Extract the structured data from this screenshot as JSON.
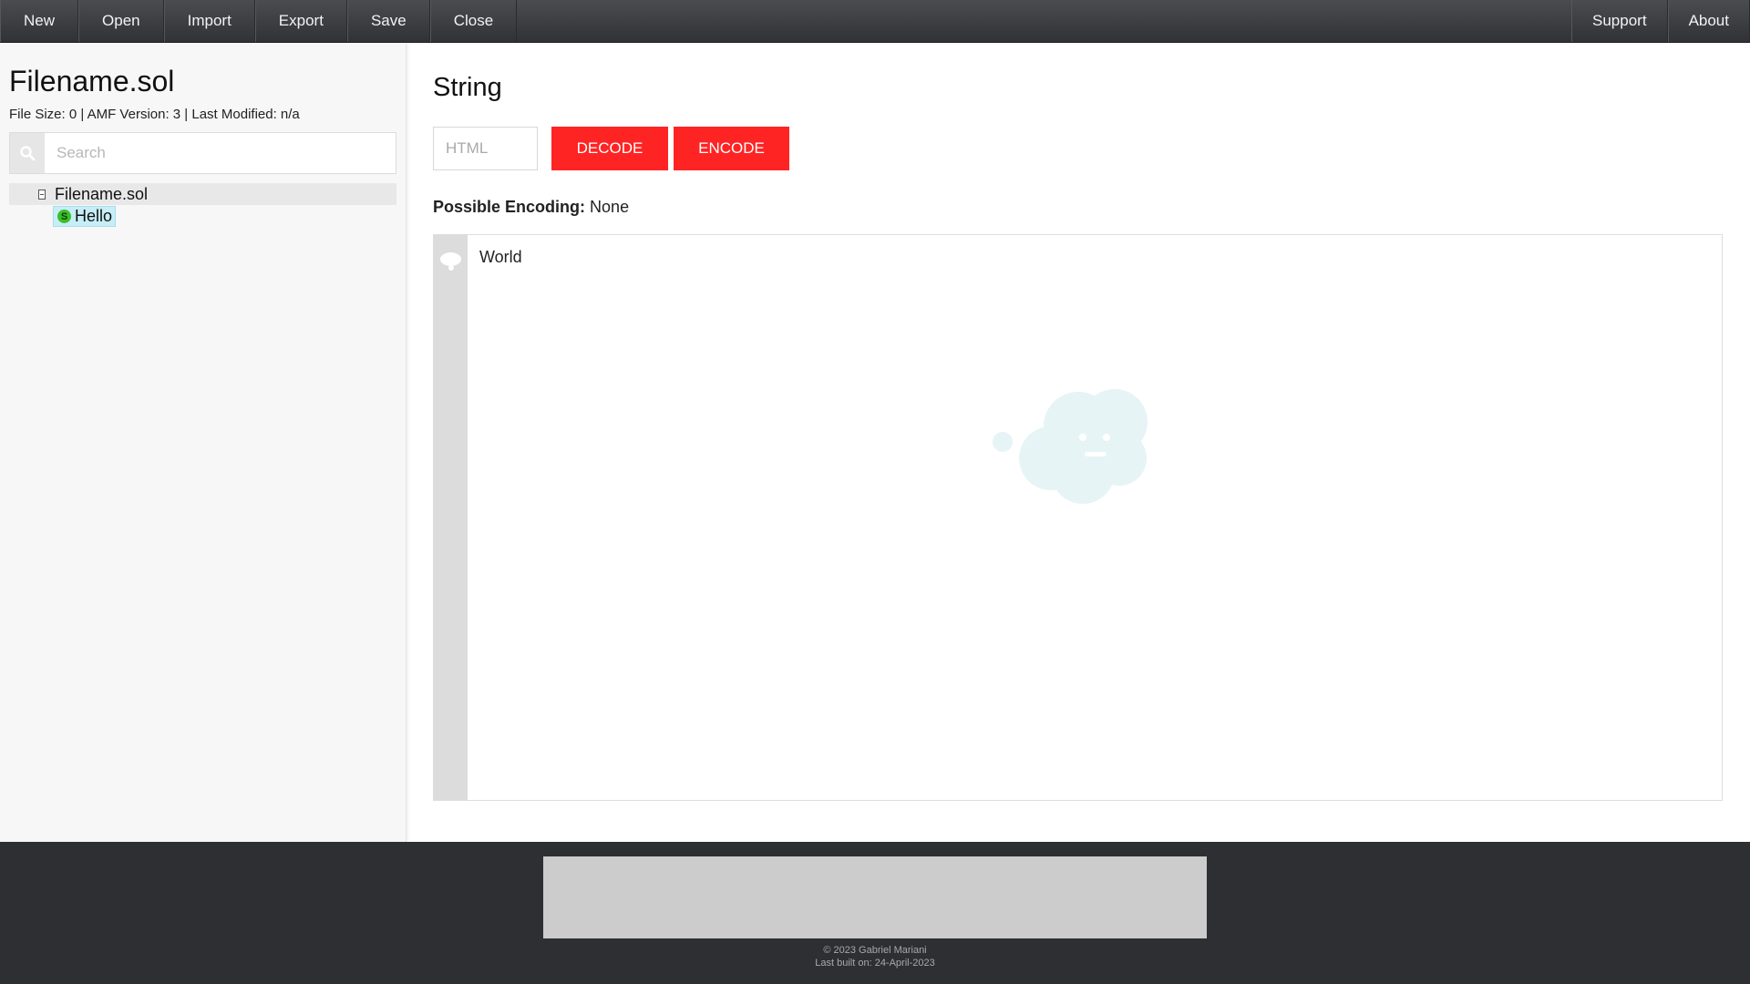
{
  "nav": {
    "left": [
      "New",
      "Open",
      "Import",
      "Export",
      "Save",
      "Close"
    ],
    "right": [
      "Support",
      "About"
    ]
  },
  "sidebar": {
    "file_title": "Filename.sol",
    "file_meta": "File Size: 0 | AMF Version: 3 | Last Modified: n/a",
    "search_placeholder": "Search",
    "tree": {
      "root_label": "Filename.sol",
      "child_badge": "S",
      "child_label": "Hello"
    }
  },
  "main": {
    "title": "String",
    "encoding_input_placeholder": "HTML",
    "decode_label": "DECODE",
    "encode_label": "ENCODE",
    "possible_encoding_label": "Possible Encoding:",
    "possible_encoding_value": "None",
    "editor_value": "World"
  },
  "footer": {
    "copyright": "© 2023 Gabriel Mariani",
    "last_built": "Last built on: 24-April-2023"
  },
  "colors": {
    "accent": "#ff2424",
    "nav_bg": "#3b3d41",
    "footer_bg": "#2e2f33",
    "selected_bg": "#c7eef6"
  }
}
